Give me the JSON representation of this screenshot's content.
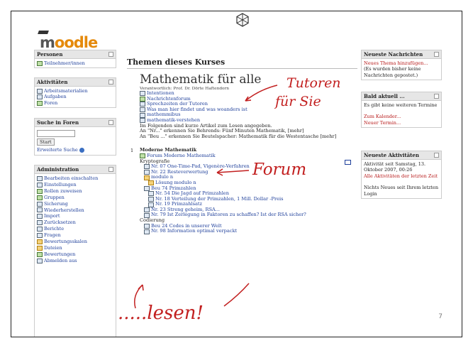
{
  "brand": {
    "logo_main": "m",
    "logo_rest": "oodle"
  },
  "slide_number": "7",
  "course": {
    "section_title": "Themen dieses Kurses",
    "main_title": "Mathematik für alle",
    "responsible": "Verantwortlich: Prof. Dr. Dörte Haftendorn",
    "intro_links": [
      "Intentionen",
      "Nachrichtenforum",
      "Sprechzeiten der Tutoren",
      "Was man hier findet und was woanders ist",
      "mathemmibus",
      "mathematik-verstehen"
    ],
    "text_lines": [
      "Im Folgenden sind kurze Artikel zum Lesen angegeben.",
      "An \"Nr...\" erkennen Sie Behrends: Fünf Minuten Mathematik, [mehr]",
      "An \"Beu ...\" erkennen Sie Beutelspacher: Mathematik für die Westentasche [mehr]"
    ],
    "section1_number": "1",
    "section1_title": "Moderne Mathematik",
    "forum_link": "Forum Moderne Mathematik",
    "group1_label": "Kryptografie",
    "crypto_items": [
      "Nr. 07 One-Time-Pad, Vigenère-Verfahren",
      "Nr. 22 Resteverwertung",
      "modulo n",
      "Lösung modulo n",
      "Beu 74 Primzahlen",
      "Nr. 54 Die Jagd auf Primzahlen",
      "Nr. 18 Verteilung der Primzahlen, 1 Mill. Dollar -Preis",
      "Nr. 19 Primzahlsatz",
      "Nr. 23 Streng geheim, RSA...",
      "Nr. 79 Ist Zerlegung in Faktoren zu schaffen? Ist der RSA sicher?"
    ],
    "group2_label": "Codierung",
    "coding_items": [
      "Beu 24 Codes in unserer Welt",
      "Nr. 98 Information optimal verpackt"
    ]
  },
  "left": {
    "people": {
      "title": "Personen",
      "items": [
        "Teilnehmer/innen"
      ]
    },
    "activities": {
      "title": "Aktivitäten",
      "items": [
        "Arbeitsmaterialien",
        "Aufgaben",
        "Foren"
      ]
    },
    "search": {
      "title": "Suche in Foren",
      "button": "Start",
      "advanced": "Erweiterte Suche"
    },
    "admin": {
      "title": "Administration",
      "items": [
        "Bearbeiten einschalten",
        "Einstellungen",
        "Rollen zuweisen",
        "Gruppen",
        "Sicherung",
        "Wiederherstellen",
        "Import",
        "Zurücksetzen",
        "Berichte",
        "Fragen",
        "Bewertungsskalen",
        "Dateien",
        "Bewertungen",
        "Abmelden aus"
      ]
    }
  },
  "right": {
    "news": {
      "title": "Neueste Nachrichten",
      "link": "Neues Thema hinzufügen...",
      "text": "(Es wurden bisher keine Nachrichten gepostet.)"
    },
    "upcoming": {
      "title": "Bald aktuell ...",
      "text": "Es gibt keine weiteren Termine",
      "link1": "Zum Kalender...",
      "link2": "Neuer Termin..."
    },
    "activity": {
      "title": "Neueste Aktivitäten",
      "since": "Aktivität seit Samstag, 13. Oktober 2007, 00:26",
      "link": "Alle Aktivitäten der letzten Zeit",
      "none": "Nichts Neues seit Ihrem letzten Login"
    }
  },
  "annotations": {
    "tutoren1": "Tutoren",
    "tutoren2": "für Sie",
    "forum": "Forum",
    "lesen": ".....lesen!"
  },
  "colors": {
    "link": "#1d3e9a",
    "annotation": "#c21f1f",
    "logo": "#e58a0c"
  }
}
